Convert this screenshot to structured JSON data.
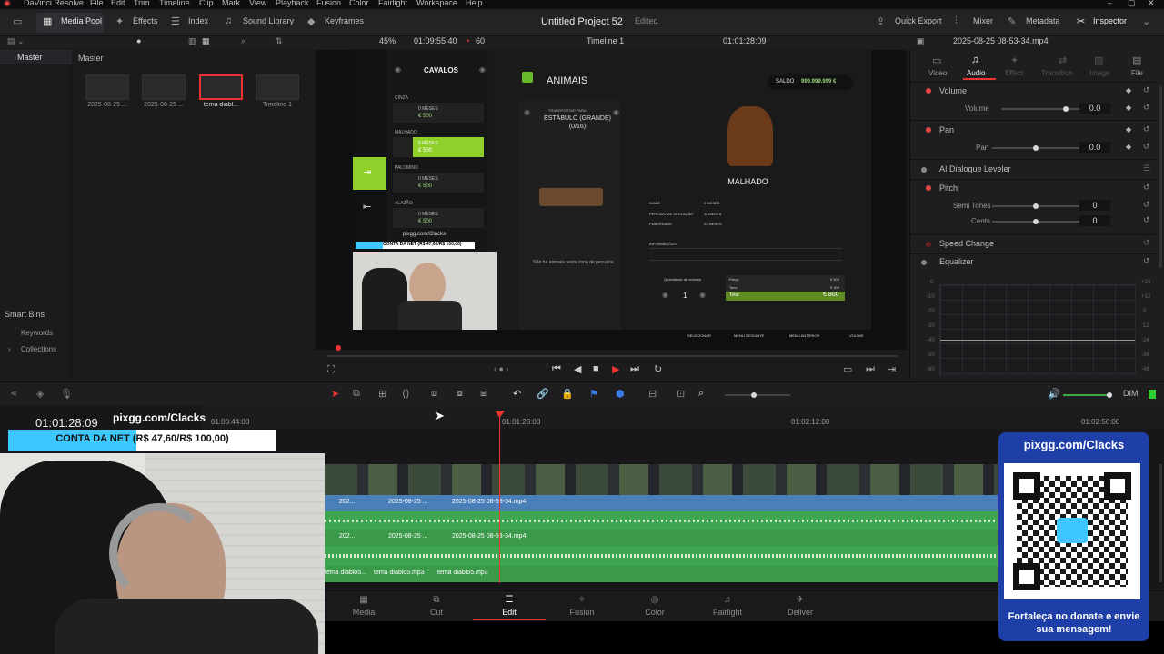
{
  "menubar": {
    "app": "DaVinci Resolve",
    "items": [
      "File",
      "Edit",
      "Trim",
      "Timeline",
      "Clip",
      "Mark",
      "View",
      "Playback",
      "Fusion",
      "Color",
      "Fairlight",
      "Workspace",
      "Help"
    ]
  },
  "toolbar": {
    "left": [
      "Media Pool",
      "Effects",
      "Index",
      "Sound Library",
      "Keyframes"
    ],
    "project": "Untitled Project 52",
    "status": "Edited",
    "right": [
      "Quick Export",
      "Mixer",
      "Metadata",
      "Inspector"
    ]
  },
  "viewerbar": {
    "zoom": "45%",
    "tc_src": "01:09:55:40",
    "fps": "60",
    "timeline": "Timeline 1",
    "tc_rec": "01:01:28:09",
    "clipname": "2025-08-25 08-53-34.mp4"
  },
  "bins": {
    "master": "Master",
    "smart": "Smart Bins",
    "keywords": "Keywords",
    "collections": "Collections"
  },
  "pool": {
    "header": "Master",
    "clips": [
      {
        "name": "2025-08-25 ...",
        "color": "#2d3135"
      },
      {
        "name": "2025-08-25 ...",
        "color": "#2b2b2b"
      },
      {
        "name": "tema diabl...",
        "color": "#3fa34d"
      },
      {
        "name": "Timeline 1",
        "color": "#3a3f44"
      }
    ]
  },
  "game": {
    "cavalos": "CAVALOS",
    "list": [
      {
        "title": "CINZA",
        "age": "0 MESES",
        "price": "€ 500"
      },
      {
        "title": "MALHADO",
        "age": "0 MESES",
        "price": "€ 500"
      },
      {
        "title": "PALOMINO",
        "age": "0 MESES",
        "price": "€ 500"
      },
      {
        "title": "ALAZÃO",
        "age": "0 MESES",
        "price": "€ 500"
      }
    ],
    "animais": "ANIMAIS",
    "saldo_label": "SALDO",
    "saldo": "999.999.999 €",
    "transport_small": "TRANSPORTAR PARA:",
    "transport": "ESTÁBULO (GRANDE) (0/16)",
    "horse_name": "MALHADO",
    "stats": [
      [
        "IDADE",
        "0 MESES"
      ],
      [
        "PERÍODO DE GESTAÇÃO",
        "11 MESES"
      ],
      [
        "PUBERDADE",
        "22 MESES"
      ]
    ],
    "info_title": "INFORMAÇÕES",
    "no_animals": "Não há animais nesta zona de pecuária.",
    "qty_label": "Quantidade de animais",
    "qty": "1",
    "price_rows": [
      [
        "Preço",
        "€ 500"
      ],
      [
        "Taxa",
        "€ 300"
      ]
    ],
    "total_label": "Total",
    "total": "€ 800",
    "footer": [
      "SELECIONAR",
      "MENU SEGUINTE",
      "MENU ANTERIOR",
      "VOLTAR"
    ],
    "stream_site": "pixgg.com/Clacks",
    "stream_bar": "CONTA DA NET (R$ 47,60/R$ 100,00)"
  },
  "inspector": {
    "tabs": [
      "Video",
      "Audio",
      "Effect",
      "Transition",
      "Image",
      "File"
    ],
    "volume": {
      "title": "Volume",
      "label": "Volume",
      "value": "0.0",
      "level": 0.79
    },
    "pan": {
      "title": "Pan",
      "label": "Pan",
      "value": "0.0",
      "level": 0.5
    },
    "ai": "AI Dialogue Leveler",
    "pitch": {
      "title": "Pitch",
      "semi_label": "Semi Tones",
      "semi": "0",
      "cents_label": "Cents",
      "cents": "0"
    },
    "speed": "Speed Change",
    "eq": "Equalizer",
    "eq_scale": [
      "+24",
      "+12",
      "0",
      "-12",
      "-24",
      "-36",
      "-48"
    ],
    "eq_left": [
      "0",
      "-10",
      "-20",
      "-30",
      "-40",
      "-50",
      "-60"
    ]
  },
  "timeline": {
    "tc": "01:01:28:09",
    "ruler": [
      "01:00:44:00",
      "01:01:28:00",
      "01:02:12:00",
      "01:02:56:00"
    ],
    "dim": "DIM",
    "video_clips": [
      "202...",
      "2025-08-25 ...",
      "2025-08-25 08-53-34.mp4"
    ],
    "audio1": [
      "202...",
      "2025-08-25 ...",
      "2025-08-25 08-53-34.mp4"
    ],
    "audio2": [
      "tema diablo5...",
      "tema diablo5.mp3",
      "tema diablo5.mp3"
    ]
  },
  "overlay": {
    "site": "pixgg.com/Clacks",
    "bar": "CONTA DA NET (R$ 47,60/R$ 100,00)",
    "qr_title": "pixgg.com/Clacks",
    "qr_text": "Fortaleça no donate e envie sua mensagem!"
  },
  "pages": [
    "Media",
    "Cut",
    "Edit",
    "Fusion",
    "Color",
    "Fairlight",
    "Deliver"
  ]
}
